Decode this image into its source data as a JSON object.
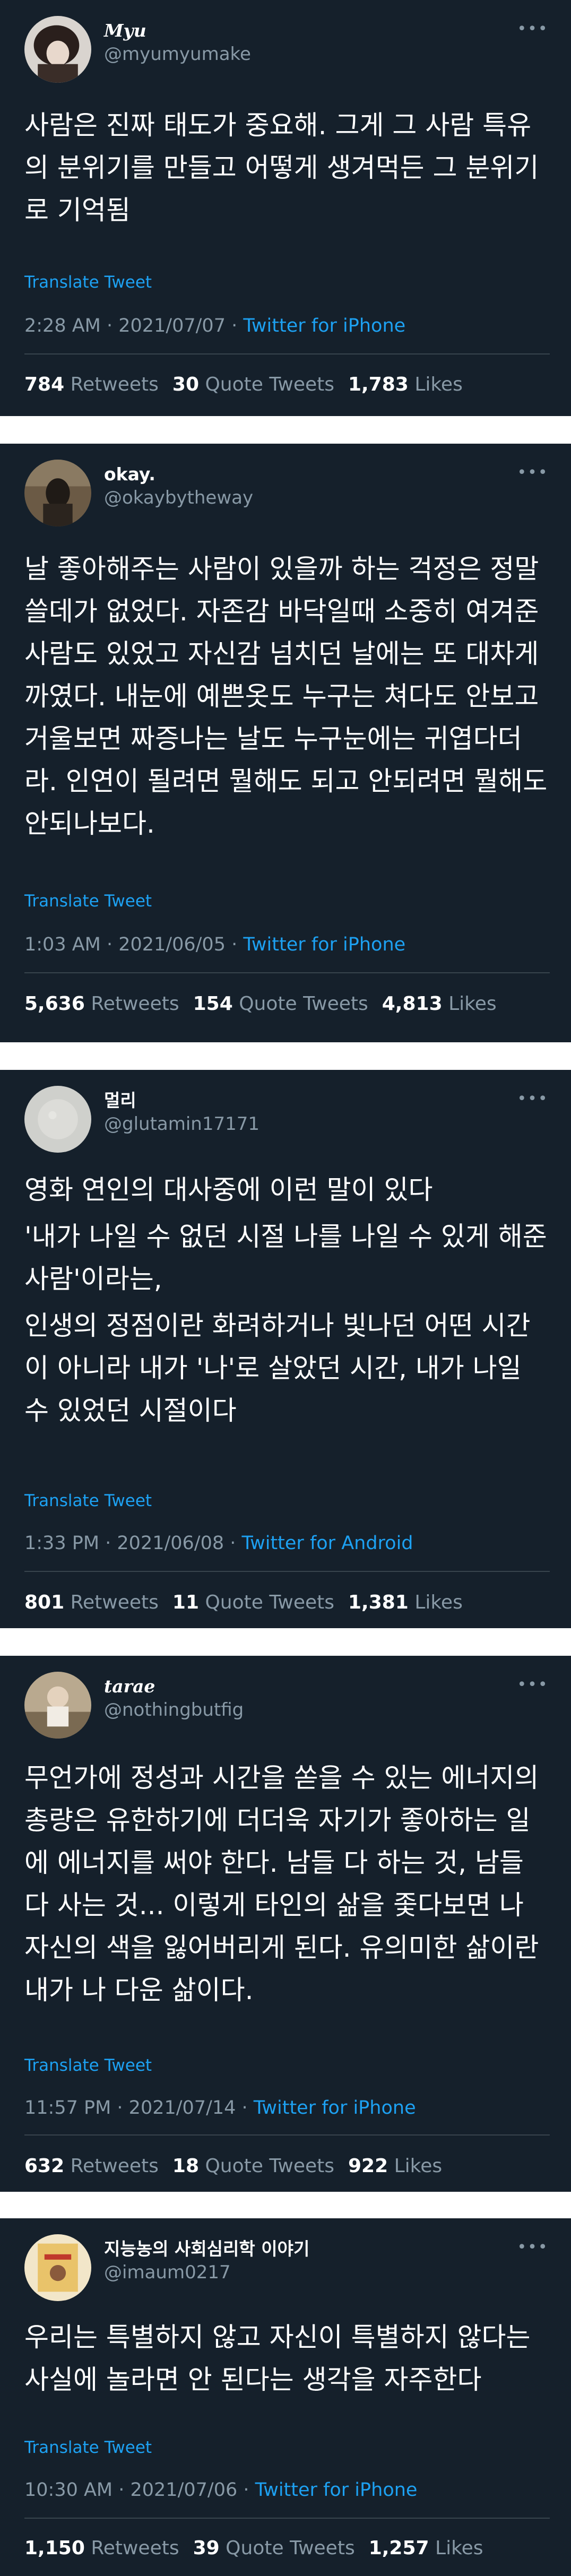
{
  "tweets": [
    {
      "name": "Myu",
      "handle": "@myumyumake",
      "body": [
        "사람은 진짜 태도가 중요해. 그게 그 사람 특유의 분위기를 만들고 어떻게 생겨먹든 그 분위기로 기억됨"
      ],
      "translate": "Translate Tweet",
      "time": "2:28 AM · 2021/07/07 · ",
      "source": "Twitter for iPhone",
      "retweets": "784",
      "retweets_label": "Retweets",
      "quotes": "30",
      "quotes_label": "Quote Tweets",
      "likes": "1,783",
      "likes_label": "Likes"
    },
    {
      "name": "okay.",
      "handle": "@okaybytheway",
      "body": [
        "날 좋아해주는 사람이 있을까 하는 걱정은 정말 쓸데가 없었다. 자존감 바닥일때 소중히 여겨준 사람도 있었고 자신감 넘치던 날에는 또 대차게 까였다. 내눈에 예쁜옷도 누구는 쳐다도 안보고 거울보면 짜증나는 날도 누구눈에는 귀엽다더라. 인연이 될려면 뭘해도 되고 안되려면 뭘해도 안되나보다."
      ],
      "translate": "Translate Tweet",
      "time": "1:03 AM · 2021/06/05 · ",
      "source": "Twitter for iPhone",
      "retweets": "5,636",
      "retweets_label": "Retweets",
      "quotes": "154",
      "quotes_label": "Quote Tweets",
      "likes": "4,813",
      "likes_label": "Likes"
    },
    {
      "name": "멀리",
      "handle": "@glutamin17171",
      "body": [
        "영화 연인의 대사중에 이런 말이 있다",
        "'내가 나일 수 없던 시절 나를 나일 수 있게 해준 사람'이라는,",
        "인생의 정점이란 화려하거나 빛나던 어떤 시간이 아니라 내가 '나'로 살았던 시간, 내가 나일 수 있었던 시절이다"
      ],
      "translate": "Translate Tweet",
      "time": "1:33 PM · 2021/06/08 · ",
      "source": "Twitter for Android",
      "retweets": "801",
      "retweets_label": "Retweets",
      "quotes": "11",
      "quotes_label": "Quote Tweets",
      "likes": "1,381",
      "likes_label": "Likes"
    },
    {
      "name": "tarae",
      "handle": "@nothingbutfig",
      "body": [
        "무언가에 정성과 시간을 쏟을 수 있는 에너지의 총량은 유한하기에 더더욱 자기가 좋아하는 일에 에너지를 써야 한다. 남들 다 하는 것, 남들 다 사는 것... 이렇게 타인의 삶을 좇다보면 나 자신의 색을 잃어버리게 된다. 유의미한 삶이란 내가 나 다운 삶이다."
      ],
      "translate": "Translate Tweet",
      "time": "11:57 PM · 2021/07/14 · ",
      "source": "Twitter for iPhone",
      "retweets": "632",
      "retweets_label": "Retweets",
      "quotes": "18",
      "quotes_label": "Quote Tweets",
      "likes": "922",
      "likes_label": "Likes"
    },
    {
      "name": "지능농의 사회심리학 이야기",
      "handle": "@imaum0217",
      "body": [
        "우리는 특별하지 않고 자신이 특별하지 않다는 사실에 놀라면 안 된다는 생각을 자주한다"
      ],
      "translate": "Translate Tweet",
      "time": "10:30 AM · 2021/07/06 · ",
      "source": "Twitter for iPhone",
      "retweets": "1,150",
      "retweets_label": "Retweets",
      "quotes": "39",
      "quotes_label": "Quote Tweets",
      "likes": "1,257",
      "likes_label": "Likes"
    }
  ],
  "more_glyph": "•••",
  "icons": {
    "more": "more-options-icon"
  },
  "colors": {
    "background": "#15202b",
    "link": "#1da1f2",
    "muted": "#8899a6",
    "divider": "#38444d"
  }
}
